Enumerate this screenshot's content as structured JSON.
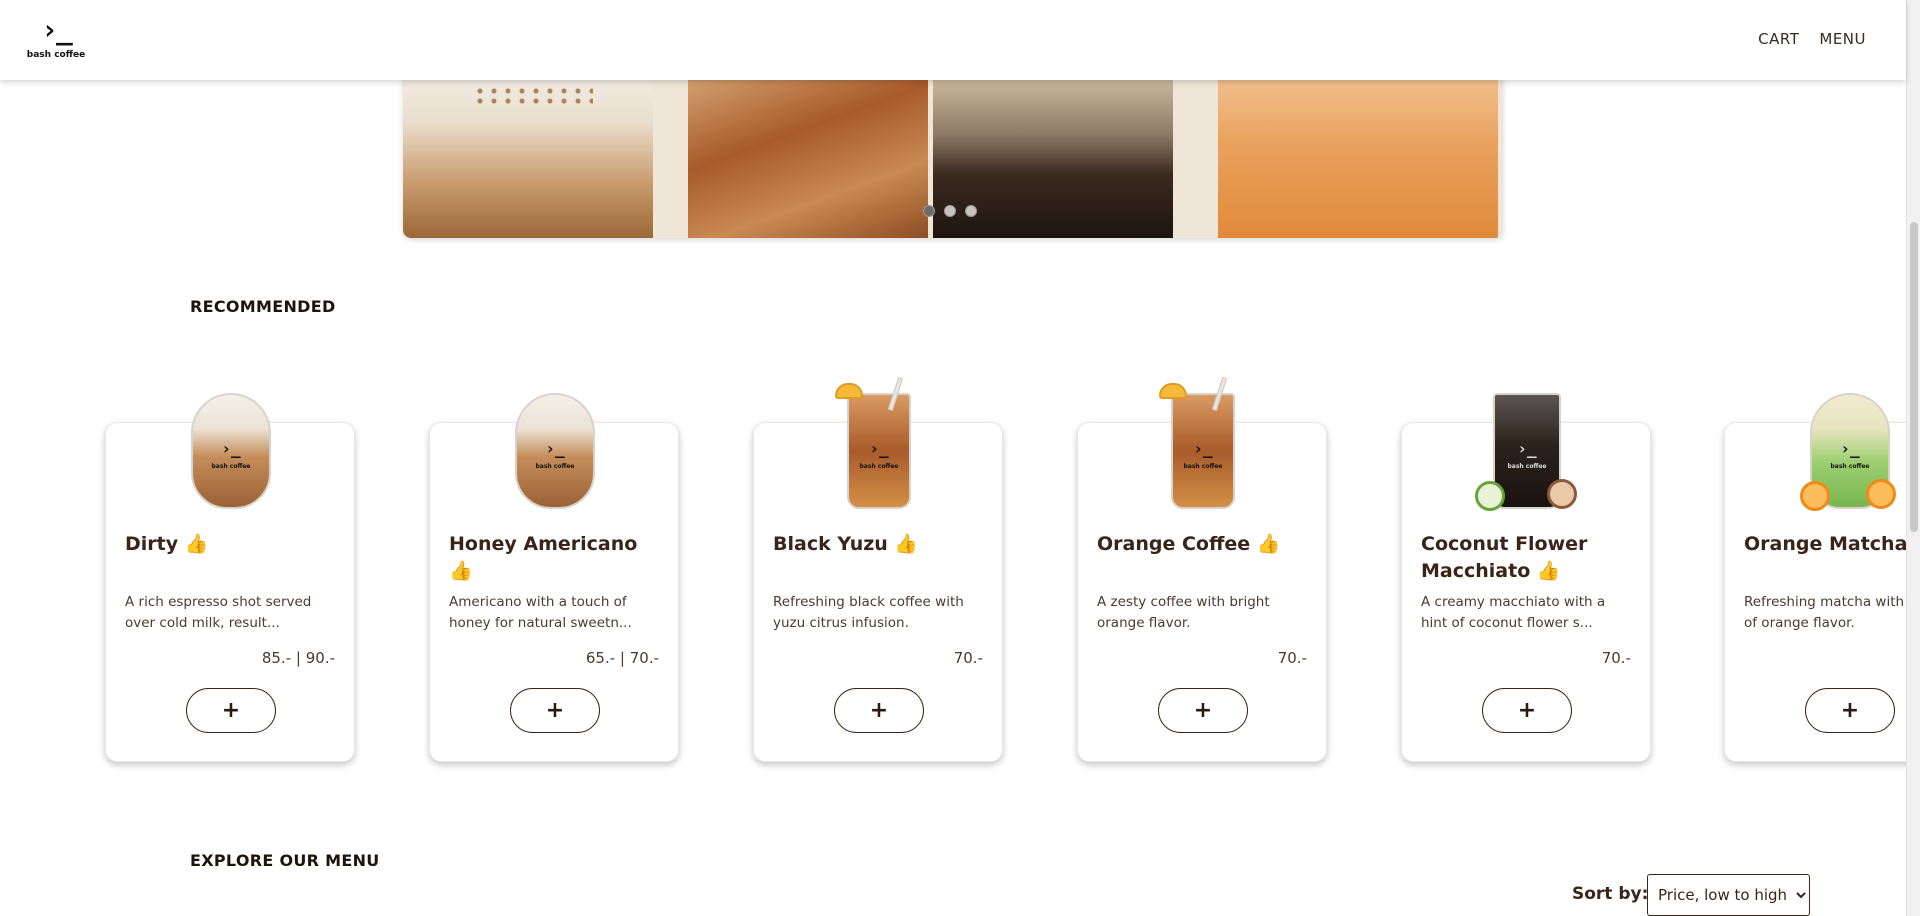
{
  "header": {
    "logo_mark": "›_",
    "logo_text": "bash coffee",
    "nav": [
      "CART",
      "MENU"
    ]
  },
  "banner": {
    "slides": 3,
    "active_slide": 1
  },
  "recommended": {
    "title": "RECOMMENDED",
    "items": [
      {
        "name": "Dirty 👍",
        "description": "A rich espresso shot served over cold milk, result...",
        "price": "85.- | 90.-",
        "cup": "latte-glass-icon"
      },
      {
        "name": "Honey Americano 👍",
        "description": "Americano with a touch of honey for natural sweetn...",
        "price": "65.- | 70.-",
        "cup": "latte-glass-icon"
      },
      {
        "name": "Black Yuzu 👍",
        "description": "Refreshing black coffee with yuzu citrus infusion.",
        "price": "70.-",
        "cup": "iced-yuzu-glass-icon"
      },
      {
        "name": "Orange Coffee 👍",
        "description": "A zesty coffee with bright orange flavor.",
        "price": "70.-",
        "cup": "iced-orange-glass-icon"
      },
      {
        "name": "Coconut Flower Macchiato 👍",
        "description": "A creamy macchiato with a hint of coconut flower s...",
        "price": "70.-",
        "cup": "iced-coconut-glass-icon"
      },
      {
        "name": "Orange Matcha 👍",
        "description": "Refreshing matcha with a hint of orange flavor.",
        "price": "",
        "cup": "matcha-glass-icon"
      }
    ],
    "add_label": "+",
    "cup_logo_mark": "›_",
    "cup_logo_text": "bash coffee"
  },
  "explore": {
    "title": "EXPLORE OUR MENU",
    "sort_label": "Sort by:",
    "sort_selected": "Price, low to high"
  },
  "colors": {
    "text_dark": "#3a2418",
    "button_border": "#3a2418",
    "background": "#ffffff"
  }
}
